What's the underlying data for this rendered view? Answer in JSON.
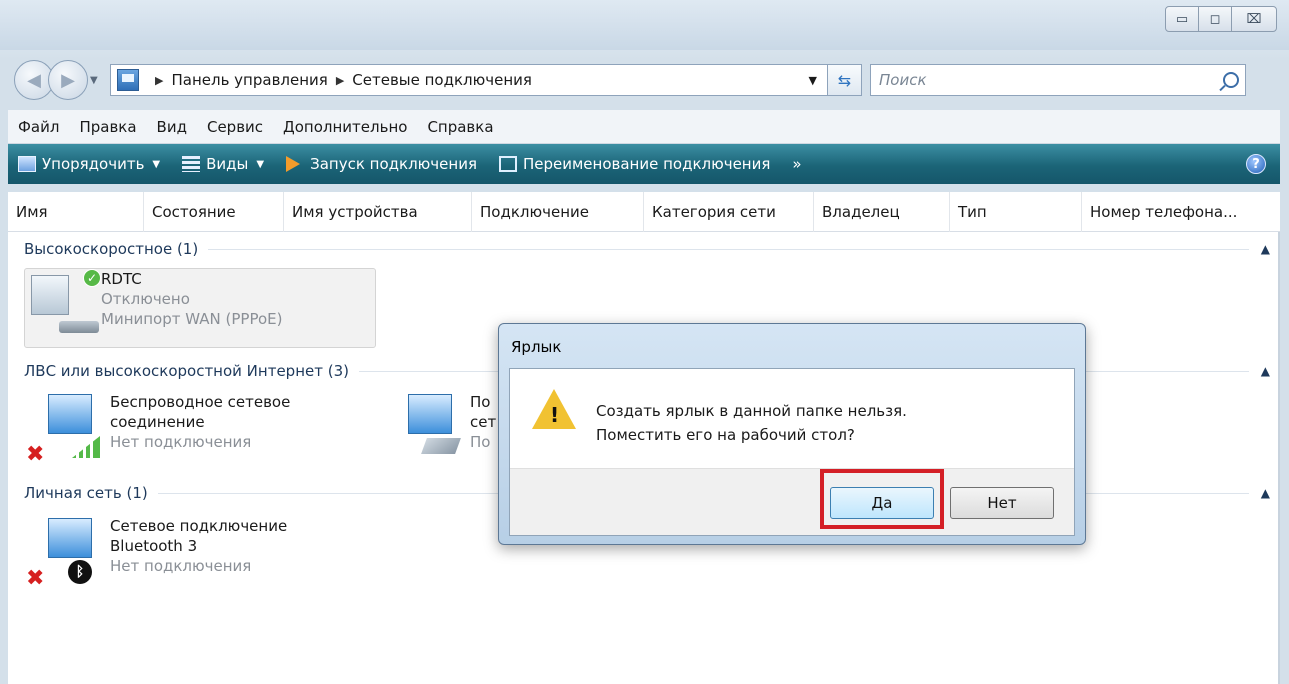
{
  "window": {
    "controls": {
      "minimize": "▭",
      "maximize": "◻",
      "close": "⌧"
    }
  },
  "address": {
    "crumbs": [
      "Панель управления",
      "Сетевые подключения"
    ],
    "search_placeholder": "Поиск"
  },
  "menu": [
    "Файл",
    "Правка",
    "Вид",
    "Сервис",
    "Дополнительно",
    "Справка"
  ],
  "toolbar": {
    "organize": "Упорядочить",
    "views": "Виды",
    "start": "Запуск подключения",
    "rename": "Переименование подключения",
    "more": "»"
  },
  "columns": [
    "Имя",
    "Состояние",
    "Имя устройства",
    "Подключение",
    "Категория сети",
    "Владелец",
    "Тип",
    "Номер телефона..."
  ],
  "groups": [
    {
      "title": "Высокоскоростное (1)"
    },
    {
      "title": "ЛВС или высокоскоростной Интернет (3)"
    },
    {
      "title": "Личная сеть (1)"
    }
  ],
  "items": {
    "rdtc": {
      "name": "RDTC",
      "status": "Отключено",
      "device": "Минипорт WAN (PPPoE)"
    },
    "wireless": {
      "name1": "Беспроводное сетевое",
      "name2": "соединение",
      "status": "Нет подключения"
    },
    "lan": {
      "name1": "По",
      "name2": "сет",
      "status": "По"
    },
    "bluetooth": {
      "name1": "Сетевое подключение",
      "name2": "Bluetooth 3",
      "status": "Нет подключения"
    }
  },
  "dialog": {
    "title": "Ярлык",
    "line1": "Создать ярлык в данной папке нельзя.",
    "line2": "Поместить его на рабочий стол?",
    "yes": "Да",
    "no": "Нет"
  },
  "colors": {
    "toolbar": "#1b6477",
    "highlight": "#d41f26"
  }
}
